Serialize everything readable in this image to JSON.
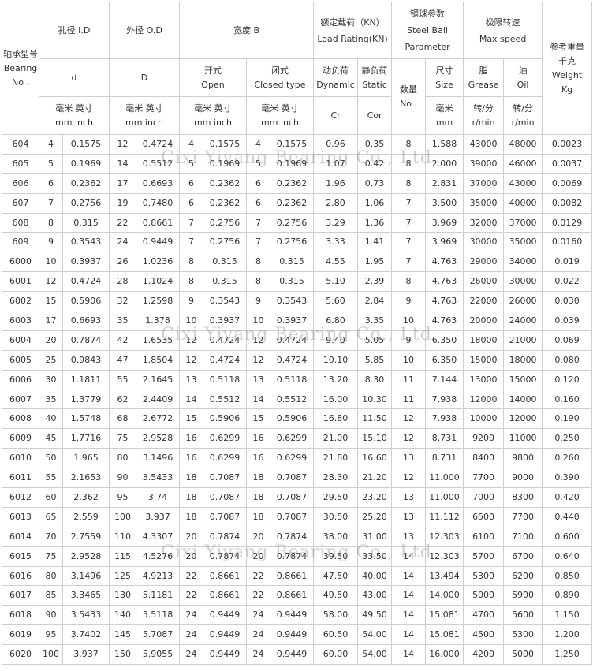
{
  "header": {
    "model": [
      "轴承型号",
      "Bearing",
      "No ."
    ],
    "id": {
      "cn": "孔径 I.D",
      "sym": "d",
      "unit_cn": "毫米 英寸",
      "unit_en": "mm inch"
    },
    "od": {
      "cn": "外径 O.D",
      "sym": "D",
      "unit_cn": "毫米 英寸",
      "unit_en": "mm inch"
    },
    "width": {
      "cn": "宽度 B",
      "open": {
        "cn": "开式",
        "en": "Open",
        "unit_cn": "毫米 英寸",
        "unit_en": "mm inch"
      },
      "closed": {
        "cn": "闭式",
        "en": "Closed type",
        "unit_cn": "毫米 英寸",
        "unit_en": "mm inch"
      }
    },
    "load": {
      "cn": "额定载荷（KN）",
      "en": "Load Rating(KN)",
      "dynamic": {
        "cn": "动负荷",
        "en": "Dynamic",
        "sym": "Cr"
      },
      "static": {
        "cn": "静负荷",
        "en": "Static",
        "sym": "Cor"
      }
    },
    "ball": {
      "cn": "钢球参数",
      "en1": "Steel Ball",
      "en2": "Parameter",
      "num": {
        "cn": "数量",
        "en": "No ."
      },
      "size": {
        "cn": "尺寸",
        "en": "Size",
        "unit_cn": "毫米",
        "unit_en": "mm"
      }
    },
    "speed": {
      "cn": "极限转速",
      "en": "Max speed",
      "grease": {
        "cn": "脂",
        "en": "Grease",
        "unit_cn": "转/分",
        "unit_en": "r/min"
      },
      "oil": {
        "cn": "油",
        "en": "Oil",
        "unit_cn": "转/分",
        "unit_en": "r/min"
      }
    },
    "weight": {
      "cn1": "参考重量",
      "cn2": "千克",
      "en": "Weight",
      "unit": "Kg"
    }
  },
  "watermark": "Cixi Yiyang Bearing Co., Ltd",
  "rows": [
    [
      "604",
      "4",
      "0.1575",
      "12",
      "0.4724",
      "4",
      "0.1575",
      "4",
      "0.1575",
      "0.96",
      "0.35",
      "8",
      "1.588",
      "43000",
      "48000",
      "0.0023"
    ],
    [
      "605",
      "5",
      "0.1969",
      "14",
      "0.5512",
      "5",
      "0.1969",
      "5",
      "0.1969",
      "1.07",
      "0.42",
      "8",
      "2.000",
      "39000",
      "46000",
      "0.0037"
    ],
    [
      "606",
      "6",
      "0.2362",
      "17",
      "0.6693",
      "6",
      "0.2362",
      "6",
      "0.2362",
      "1.96",
      "0.73",
      "8",
      "2.831",
      "37000",
      "43000",
      "0.0069"
    ],
    [
      "607",
      "7",
      "0.2756",
      "19",
      "0.7480",
      "6",
      "0.2362",
      "6",
      "0.2362",
      "2.80",
      "1.06",
      "7",
      "3.500",
      "35000",
      "40000",
      "0.0082"
    ],
    [
      "608",
      "8",
      "0.315",
      "22",
      "0.8661",
      "7",
      "0.2756",
      "7",
      "0.2756",
      "3.29",
      "1.36",
      "7",
      "3.969",
      "32000",
      "37000",
      "0.0129"
    ],
    [
      "609",
      "9",
      "0.3543",
      "24",
      "0.9449",
      "7",
      "0.2756",
      "7",
      "0.2756",
      "3.33",
      "1.41",
      "7",
      "3.969",
      "30000",
      "35000",
      "0.0160"
    ],
    [
      "6000",
      "10",
      "0.3937",
      "26",
      "1.0236",
      "8",
      "0.315",
      "8",
      "0.315",
      "4.55",
      "1.95",
      "7",
      "4.763",
      "29000",
      "34000",
      "0.019"
    ],
    [
      "6001",
      "12",
      "0.4724",
      "28",
      "1.1024",
      "8",
      "0.315",
      "8",
      "0.315",
      "5.10",
      "2.39",
      "8",
      "4.763",
      "26000",
      "30000",
      "0.022"
    ],
    [
      "6002",
      "15",
      "0.5906",
      "32",
      "1.2598",
      "9",
      "0.3543",
      "9",
      "0.3543",
      "5.60",
      "2.84",
      "9",
      "4.763",
      "22000",
      "26000",
      "0.030"
    ],
    [
      "6003",
      "17",
      "0.6693",
      "35",
      "1.378",
      "10",
      "0.3937",
      "10",
      "0.3937",
      "6.80",
      "3.35",
      "10",
      "4.763",
      "20000",
      "24000",
      "0.039"
    ],
    [
      "6004",
      "20",
      "0.7874",
      "42",
      "1.6535",
      "12",
      "0.4724",
      "12",
      "0.4724",
      "9.40",
      "5.05",
      "9",
      "6.350",
      "18000",
      "21000",
      "0.069"
    ],
    [
      "6005",
      "25",
      "0.9843",
      "47",
      "1.8504",
      "12",
      "0.4724",
      "12",
      "0.4724",
      "10.10",
      "5.85",
      "10",
      "6.350",
      "15000",
      "18000",
      "0.080"
    ],
    [
      "6006",
      "30",
      "1.1811",
      "55",
      "2.1645",
      "13",
      "0.5118",
      "13",
      "0.5118",
      "13.20",
      "8.30",
      "11",
      "7.144",
      "13000",
      "15000",
      "0.120"
    ],
    [
      "6007",
      "35",
      "1.3779",
      "62",
      "2.4409",
      "14",
      "0.5512",
      "14",
      "0.5512",
      "16.00",
      "10.30",
      "11",
      "7.938",
      "12000",
      "14000",
      "0.160"
    ],
    [
      "6008",
      "40",
      "1.5748",
      "68",
      "2.6772",
      "15",
      "0.5906",
      "15",
      "0.5906",
      "16.80",
      "11.50",
      "12",
      "7.938",
      "10000",
      "12000",
      "0.190"
    ],
    [
      "6009",
      "45",
      "1.7716",
      "75",
      "2.9528",
      "16",
      "0.6299",
      "16",
      "0.6299",
      "21.00",
      "15.10",
      "12",
      "8.731",
      "9200",
      "11000",
      "0.250"
    ],
    [
      "6010",
      "50",
      "1.965",
      "80",
      "3.1496",
      "16",
      "0.6299",
      "16",
      "0.6299",
      "21.80",
      "16.60",
      "13",
      "8.731",
      "8400",
      "9800",
      "0.260"
    ],
    [
      "6011",
      "55",
      "2.1653",
      "90",
      "3.5433",
      "18",
      "0.7087",
      "18",
      "0.7087",
      "28.30",
      "21.20",
      "12",
      "11.000",
      "7700",
      "9000",
      "0.390"
    ],
    [
      "6012",
      "60",
      "2.362",
      "95",
      "3.74",
      "18",
      "0.7087",
      "18",
      "0.7087",
      "29.50",
      "23.20",
      "13",
      "11.000",
      "7000",
      "8300",
      "0.420"
    ],
    [
      "6013",
      "65",
      "2.559",
      "100",
      "3.937",
      "18",
      "0.7087",
      "18",
      "0.7087",
      "30.50",
      "25.20",
      "13",
      "11.112",
      "6500",
      "7700",
      "0.440"
    ],
    [
      "6014",
      "70",
      "2.7559",
      "110",
      "4.3307",
      "20",
      "0.7874",
      "20",
      "0.7874",
      "38.00",
      "31.00",
      "13",
      "12.303",
      "6100",
      "7100",
      "0.600"
    ],
    [
      "6015",
      "75",
      "2.9528",
      "115",
      "4.5276",
      "20",
      "0.7874",
      "20",
      "0.7874",
      "39.50",
      "33.50",
      "14",
      "12.303",
      "5700",
      "6700",
      "0.640"
    ],
    [
      "6016",
      "80",
      "3.1496",
      "125",
      "4.9213",
      "22",
      "0.8661",
      "22",
      "0.8661",
      "47.50",
      "40.00",
      "14",
      "13.494",
      "5300",
      "6200",
      "0.850"
    ],
    [
      "6017",
      "85",
      "3.3465",
      "130",
      "5.1181",
      "22",
      "0.8661",
      "22",
      "0.8661",
      "49.50",
      "43.00",
      "14",
      "14.000",
      "5000",
      "5900",
      "0.890"
    ],
    [
      "6018",
      "90",
      "3.5433",
      "140",
      "5.5118",
      "24",
      "0.9449",
      "24",
      "0.9449",
      "58.00",
      "49.50",
      "14",
      "15.081",
      "4700",
      "5600",
      "1.150"
    ],
    [
      "6019",
      "95",
      "3.7402",
      "145",
      "5.7087",
      "24",
      "0.9449",
      "24",
      "0.9449",
      "60.50",
      "54.00",
      "14",
      "15.081",
      "4500",
      "5300",
      "1.200"
    ],
    [
      "6020",
      "100",
      "3.937",
      "150",
      "5.9055",
      "24",
      "0.9449",
      "24",
      "0.9449",
      "60.00",
      "54.00",
      "14",
      "16.000",
      "4200",
      "5000",
      "1.250"
    ]
  ]
}
